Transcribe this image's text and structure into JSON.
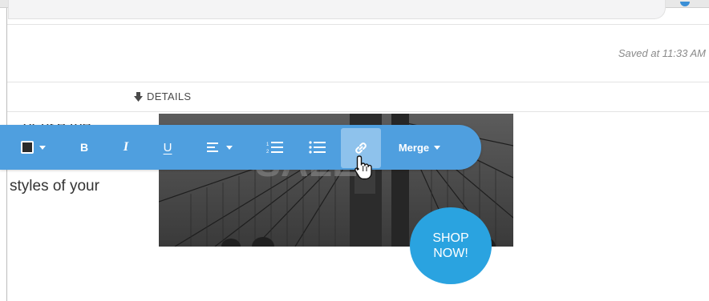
{
  "header": {
    "saved_status": "Saved at 11:33 AM"
  },
  "details_bar": {
    "label": "DETAILS",
    "icon": "arrow-down-icon"
  },
  "editor": {
    "text_partial_top": "...or use the",
    "text_line": "styles of your"
  },
  "hero_image": {
    "badge_line1": "SHOP",
    "badge_line2": "NOW!",
    "badge_color": "#2aa3e0"
  },
  "toolbar": {
    "background_color": "#4f9fdf",
    "active_color": "#8ec2ec",
    "text_color_swatch": "#2b2b2b",
    "bold_label": "B",
    "italic_label": "I",
    "underline_label": "U",
    "merge_label": "Merge",
    "icons": [
      "text-color-icon",
      "bold-icon",
      "italic-icon",
      "underline-icon",
      "align-left-icon",
      "ordered-list-icon",
      "unordered-list-icon",
      "link-icon"
    ],
    "active_tool": "link"
  }
}
